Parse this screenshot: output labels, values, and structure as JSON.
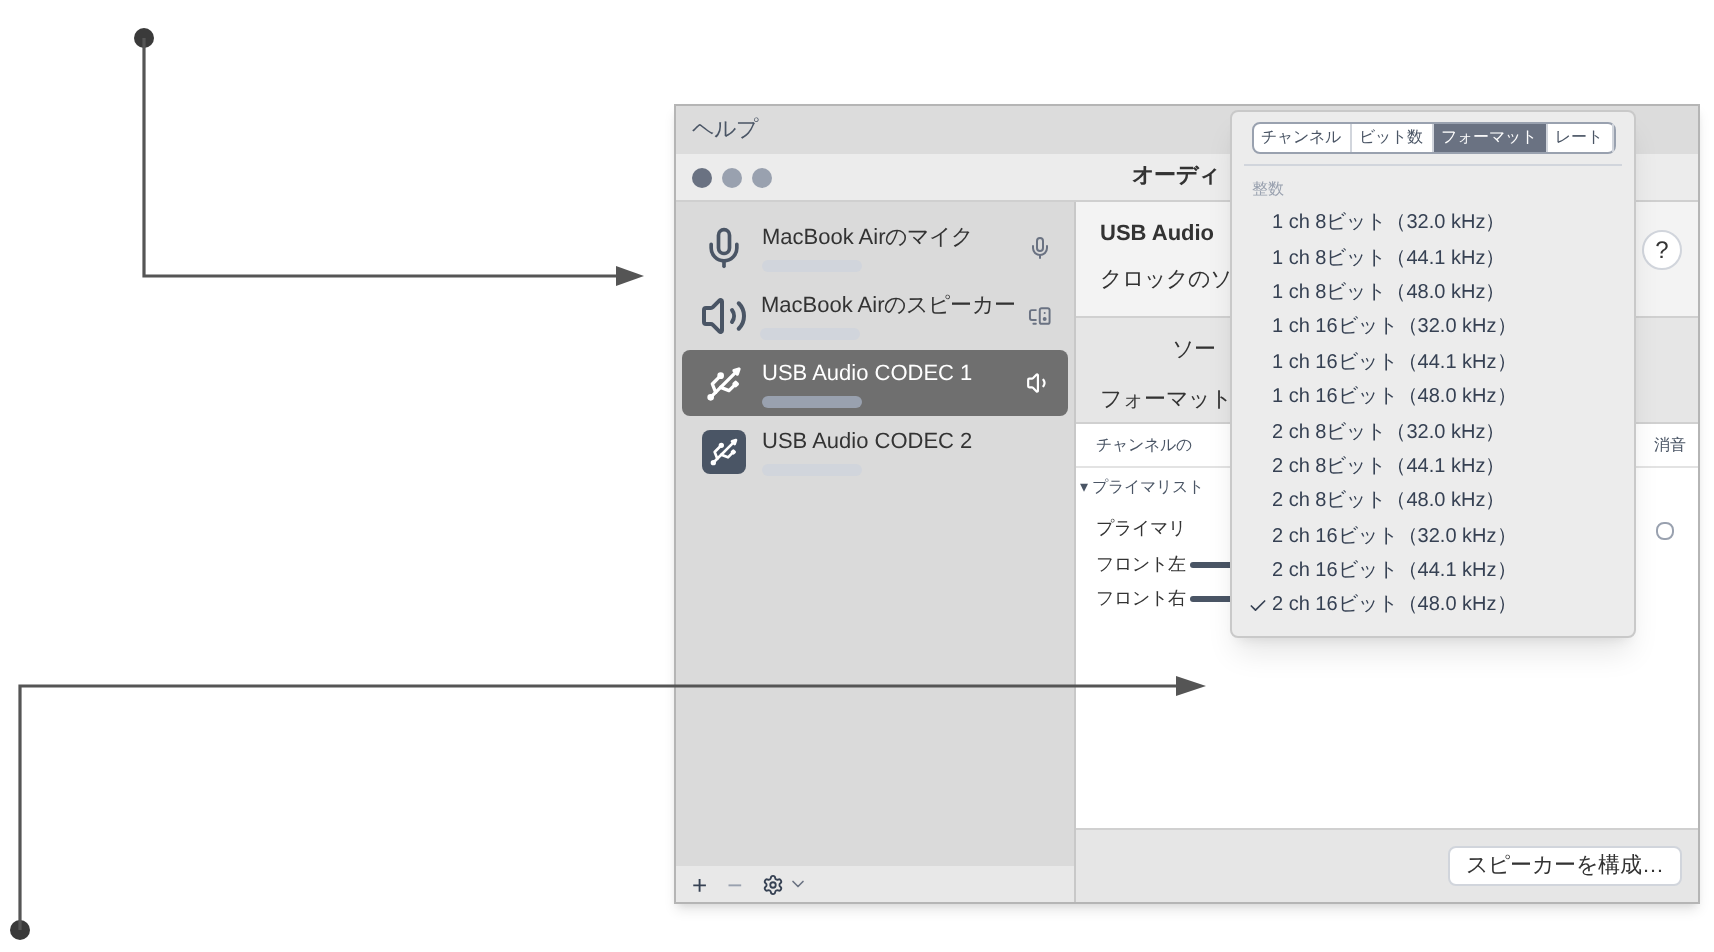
{
  "menu_bar": {
    "item": "ヘルプ"
  },
  "window": {
    "title": "オーディ"
  },
  "sidebar": {
    "devices": [
      {
        "name": "MacBook Airのマイク",
        "kind": "mic",
        "selected": false
      },
      {
        "name": "MacBook Airのスピーカー",
        "kind": "speaker",
        "selected": false
      },
      {
        "name": "USB Audio CODEC 1",
        "kind": "usb",
        "selected": true
      },
      {
        "name": "USB Audio CODEC 2",
        "kind": "usb-box",
        "selected": false
      }
    ],
    "footer_buttons": [
      "+",
      "−"
    ]
  },
  "detail": {
    "device_name": "USB Audio",
    "clock_label": "クロックのソ",
    "help": "?",
    "source_label": "ソー",
    "format_label": "フォーマット",
    "table": {
      "column_1": "チャンネルの",
      "column_2": "消音",
      "group_marker": "▾",
      "group": "プライマリスト",
      "rows": [
        {
          "label": "プライマリ",
          "kind": "heading",
          "checked": false
        },
        {
          "label": "フロント左",
          "kind": "slider"
        },
        {
          "label": "フロント右",
          "kind": "slider"
        }
      ]
    },
    "configure_button": "スピーカーを構成…"
  },
  "format_menu": {
    "tabs": [
      {
        "label": "チャンネル",
        "selected": false
      },
      {
        "label": "ビット数",
        "selected": false
      },
      {
        "label": "フォーマット",
        "selected": true
      },
      {
        "label": "レート",
        "selected": false
      }
    ],
    "section": "整数",
    "items": [
      {
        "label": "1 ch 8ビット（32.0 kHz）",
        "checked": false
      },
      {
        "label": "1 ch 8ビット（44.1 kHz）",
        "checked": false
      },
      {
        "label": "1 ch 8ビット（48.0 kHz）",
        "checked": false
      },
      {
        "label": "1 ch 16ビット（32.0 kHz）",
        "checked": false
      },
      {
        "label": "1 ch 16ビット（44.1 kHz）",
        "checked": false
      },
      {
        "label": "1 ch 16ビット（48.0 kHz）",
        "checked": false
      },
      {
        "label": "2 ch 8ビット（32.0 kHz）",
        "checked": false
      },
      {
        "label": "2 ch 8ビット（44.1 kHz）",
        "checked": false
      },
      {
        "label": "2 ch 8ビット（48.0 kHz）",
        "checked": false
      },
      {
        "label": "2 ch 16ビット（32.0 kHz）",
        "checked": false
      },
      {
        "label": "2 ch 16ビット（44.1 kHz）",
        "checked": false
      },
      {
        "label": "2 ch 16ビット（48.0 kHz）",
        "checked": true
      }
    ]
  }
}
